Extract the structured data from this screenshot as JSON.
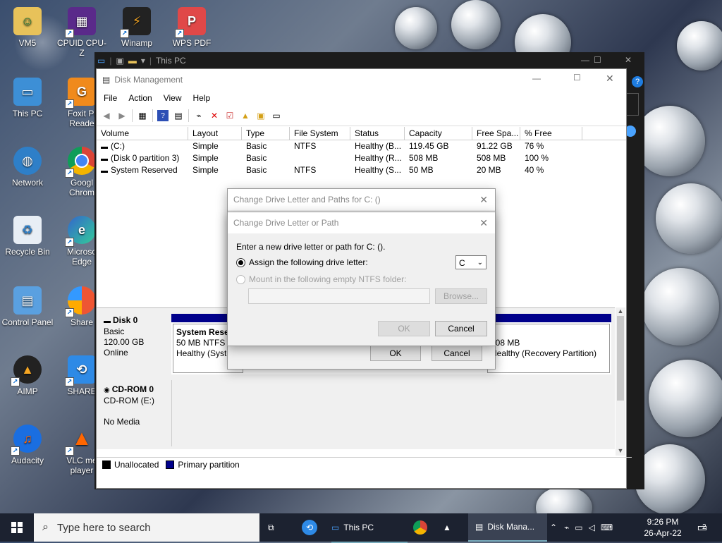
{
  "desktop_icons": [
    {
      "label": "VM5"
    },
    {
      "label": "CPUID CPU-Z"
    },
    {
      "label": "Winamp"
    },
    {
      "label": "WPS PDF"
    },
    {
      "label": "This PC"
    },
    {
      "label": "Foxit Pl\nReade"
    },
    {
      "label": "Network"
    },
    {
      "label": "Googl\nChrom"
    },
    {
      "label": "Recycle Bin"
    },
    {
      "label": "Microso\nEdge"
    },
    {
      "label": "Control Panel"
    },
    {
      "label": "Share"
    },
    {
      "label": "AIMP"
    },
    {
      "label": "SHARE"
    },
    {
      "label": "Audacity"
    },
    {
      "label": "VLC me\nplayer"
    }
  ],
  "thispc_window": {
    "title": "This PC"
  },
  "disk_mgmt": {
    "title": "Disk Management",
    "menu": [
      "File",
      "Action",
      "View",
      "Help"
    ],
    "columns": [
      "Volume",
      "Layout",
      "Type",
      "File System",
      "Status",
      "Capacity",
      "Free Spa...",
      "% Free"
    ],
    "rows": [
      [
        "(C:)",
        "Simple",
        "Basic",
        "NTFS",
        "Healthy (B...",
        "119.45 GB",
        "91.22 GB",
        "76 %"
      ],
      [
        "(Disk 0 partition 3)",
        "Simple",
        "Basic",
        "",
        "Healthy (R...",
        "508 MB",
        "508 MB",
        "100 %"
      ],
      [
        "System Reserved",
        "Simple",
        "Basic",
        "NTFS",
        "Healthy (S...",
        "50 MB",
        "20 MB",
        "40 %"
      ]
    ],
    "disk0": {
      "name": "Disk 0",
      "type": "Basic",
      "size": "120.00 GB",
      "state": "Online"
    },
    "partition_sys": {
      "name": "System Reser",
      "size": "50 MB NTFS",
      "status": "Healthy (Syste"
    },
    "partition_rec": {
      "size": "508 MB",
      "status": "Healthy (Recovery Partition)"
    },
    "cdrom": {
      "name": "CD-ROM 0",
      "type": "CD-ROM (E:)",
      "media": "No Media"
    },
    "legend": {
      "unallocated": "Unallocated",
      "primary": "Primary partition"
    }
  },
  "dialog_outer": {
    "title": "Change Drive Letter and Paths for C: ()",
    "ok": "OK",
    "cancel": "Cancel"
  },
  "dialog_inner": {
    "title": "Change Drive Letter or Path",
    "prompt": "Enter a new drive letter or path for C: ().",
    "option_assign": "Assign the following drive letter:",
    "drive_letter": "C",
    "option_mount": "Mount in the following empty NTFS folder:",
    "browse": "Browse...",
    "ok": "OK",
    "cancel": "Cancel"
  },
  "taskbar": {
    "search_placeholder": "Type here to search",
    "apps": [
      {
        "label": "This PC"
      },
      {
        "label": "Disk Mana..."
      }
    ],
    "time": "9:26 PM",
    "date": "26-Apr-22",
    "notification_count": "2"
  },
  "colors": {
    "primary_partition": "#00008b",
    "taskbar": "#1c2230"
  }
}
